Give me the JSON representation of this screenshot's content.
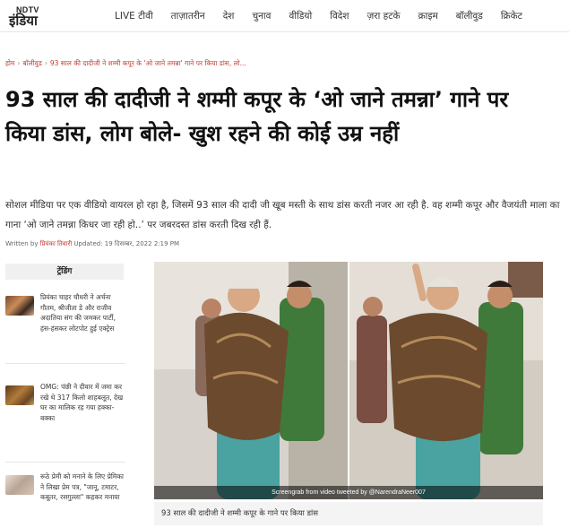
{
  "header": {
    "logo_top": "NDTV",
    "logo_bottom": "इंडिया",
    "nav": [
      "LIVE टीवी",
      "ताज़ातरीन",
      "देश",
      "चुनाव",
      "वीडियो",
      "विदेश",
      "ज़रा हटके",
      "क्राइम",
      "बॉलीवुड",
      "क्रिकेट"
    ]
  },
  "breadcrumb": {
    "home": "होम",
    "section": "बॉलीवुड",
    "current": "93 साल की दादीजी ने शम्मी कपूर के 'ओ जाने तमन्ना' गाने पर किया डांस, लो..."
  },
  "article": {
    "headline": "93 साल की दादीजी ने शम्मी कपूर के ‘ओ जाने तमन्ना’ गाने पर किया डांस, लोग बोले- खुश रहने की कोई उम्र नहीं",
    "summary": "सोशल मीडिया पर एक वीडियो वायरल हो रहा है, जिसमें 93 साल की दादी जी खूब मस्ती के साथ डांस करती नजर आ रही है. वह शम्मी कपूर और वैजयंती माला का गाना ‘ओ जाने तमन्ना किधर जा रही हो..’  पर जबरदस्त डांस करती दिख रही हैं.",
    "byline_prefix": "Written by",
    "author": "प्रियंका तिवारी",
    "updated": "Updated: 19 दिसम्बर, 2022 2:19 PM",
    "image_credit": "Screengrab from video tweeted by @NarendraNeer007",
    "image_caption": "93 साल की दादीजी ने शम्मी कपूर के गाने पर किया डांस"
  },
  "trending": {
    "title": "ट्रेंडिंग",
    "items": [
      {
        "text": "प्रियंका चाहर चौधरी ने अर्चना गौतम, श्रीजीता डे और राजीव अदातिया संग की जमकर पार्टी, हंस-हंसकर लोटपोट हुई एक्ट्रेस",
        "thumb_color": "#8b5a3c"
      },
      {
        "text": "OMG: पंछी ने दीवार में जमा कर रखे थे 317 किलो शाहबलूत, देख घर का मालिक रह गया हक्का-बक्का",
        "thumb_color": "#a06a2a"
      },
      {
        "text": "रूठे प्रेमी को मनाने के लिए प्रेमिका ने लिखा प्रेम पत्र, \"जानू, टमाटर, कबूतर, रसगुल्ला\" कहकर मनाया",
        "thumb_color": "#c9b8a8"
      }
    ]
  },
  "colors": {
    "accent": "#c0392b",
    "scarf": "#6b4a2e",
    "green_dress": "#3f7a3a",
    "teal_dress": "#4aa3a0"
  }
}
